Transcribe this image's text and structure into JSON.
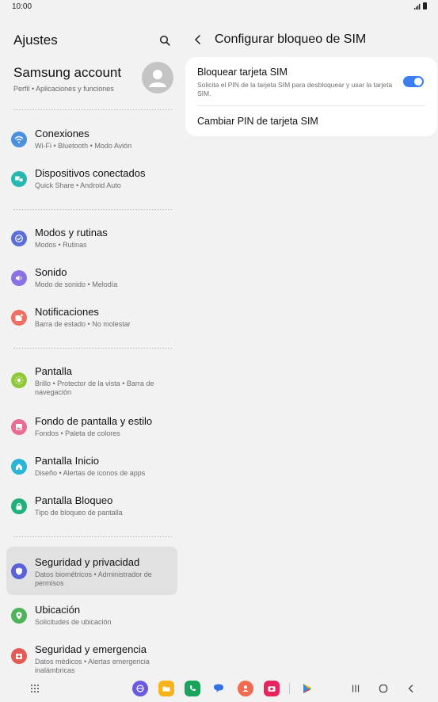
{
  "status": {
    "time": "10:00"
  },
  "left": {
    "title": "Ajustes",
    "account": {
      "name": "Samsung account",
      "sub": "Perfil  •  Aplicaciones y funciones"
    },
    "items": [
      {
        "label": "Conexiones",
        "sub": "Wi-Fi  •  Bluetooth  •  Modo Avión",
        "icon": "wifi-icon",
        "color": "#4a90e2"
      },
      {
        "label": "Dispositivos conectados",
        "sub": "Quick Share  •  Android Auto",
        "icon": "devices-icon",
        "color": "#26b8b0"
      },
      {
        "label": "Modos y rutinas",
        "sub": "Modos  •  Rutinas",
        "icon": "check-circle-icon",
        "color": "#5b6fd6"
      },
      {
        "label": "Sonido",
        "sub": "Modo de sonido  •  Melodía",
        "icon": "volume-icon",
        "color": "#8a72e6"
      },
      {
        "label": "Notificaciones",
        "sub": "Barra de estado  •  No molestar",
        "icon": "notification-icon",
        "color": "#ef6f62"
      },
      {
        "label": "Pantalla",
        "sub": "Brillo  •  Protector de la vista  •  Barra de navegación",
        "icon": "sun-icon",
        "color": "#8fc93a"
      },
      {
        "label": "Fondo de pantalla y estilo",
        "sub": "Fondos  •  Paleta de colores",
        "icon": "wallpaper-icon",
        "color": "#e96d93"
      },
      {
        "label": "Pantalla Inicio",
        "sub": "Diseño  •  Alertas de iconos de apps",
        "icon": "home-icon",
        "color": "#2ab4d6"
      },
      {
        "label": "Pantalla Bloqueo",
        "sub": "Tipo de bloqueo de pantalla",
        "icon": "lock-icon",
        "color": "#21b07a"
      },
      {
        "label": "Seguridad y privacidad",
        "sub": "Datos biométricos  •  Administrador de permisos",
        "icon": "shield-icon",
        "color": "#5a62d8"
      },
      {
        "label": "Ubicación",
        "sub": "Solicitudes de ubicación",
        "icon": "location-icon",
        "color": "#4fb35a"
      },
      {
        "label": "Seguridad y emergencia",
        "sub": "Datos médicos  •  Alertas emergencia inalámbricas",
        "icon": "emergency-icon",
        "color": "#e35a55"
      }
    ]
  },
  "right": {
    "title": "Configurar bloqueo de SIM",
    "lock_sim": {
      "title": "Bloquear tarjeta SIM",
      "sub": "Solicita el PIN de la tarjeta SIM para desbloquear y usar la tarjeta SIM.",
      "enabled": true
    },
    "change_pin": "Cambiar PIN de tarjeta SIM"
  },
  "colors": {
    "accent": "#3a7ff0",
    "active_bg": "#e1e1e1"
  }
}
